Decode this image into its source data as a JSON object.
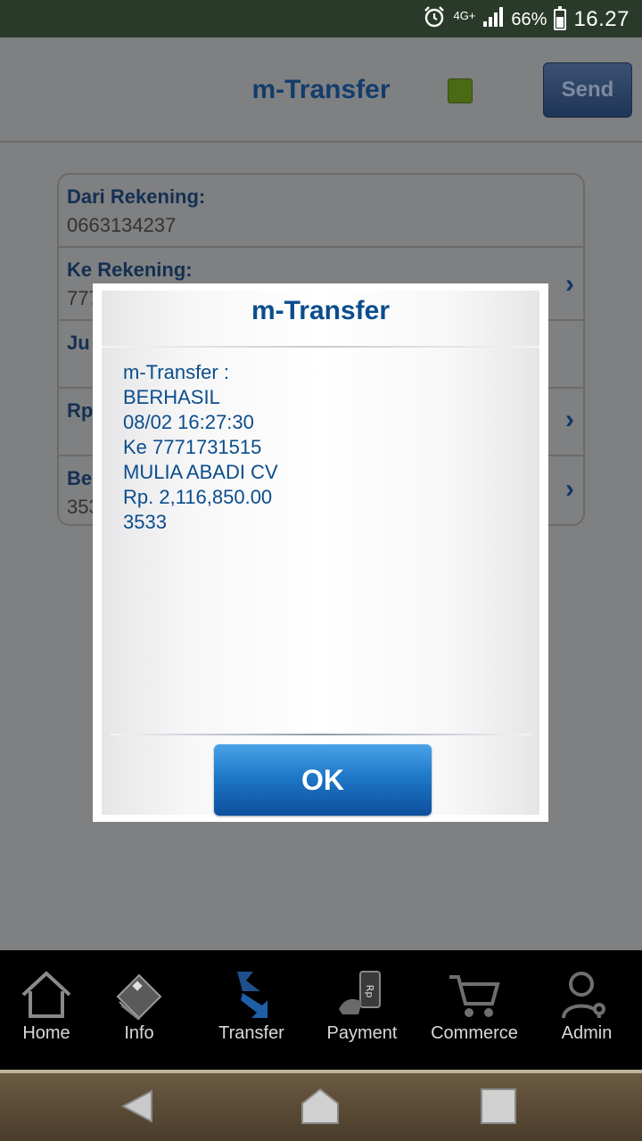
{
  "status_bar": {
    "alarm_icon": "alarm-clock-icon",
    "network": "4G+",
    "signal_icon": "signal-bars-icon",
    "battery_percent": "66%",
    "battery_icon": "battery-icon",
    "time": "16.27"
  },
  "header": {
    "title": "m-Transfer",
    "indicator_color": "#4a6a14",
    "send_label": "Send"
  },
  "form": {
    "dari_label": "Dari Rekening:",
    "dari_value": "0663134237",
    "ke_label": "Ke Rekening:",
    "ke_value_partial": "777",
    "jumlah_label_partial": "Ju",
    "rp_label_partial": "Rp",
    "berita_label_partial": "Be",
    "berita_value_partial": "353"
  },
  "dialog": {
    "title": "m-Transfer",
    "lines": [
      "m-Transfer :",
      "BERHASIL",
      "08/02 16:27:30",
      "Ke 7771731515",
      "MULIA ABADI CV",
      "Rp. 2,116,850.00",
      "3533"
    ],
    "ok_label": "OK"
  },
  "bottom_nav": {
    "items": [
      {
        "label": "Home",
        "icon": "home-icon"
      },
      {
        "label": "Info",
        "icon": "info-icon"
      },
      {
        "label": "Transfer",
        "icon": "transfer-icon"
      },
      {
        "label": "Payment",
        "icon": "payment-icon"
      },
      {
        "label": "Commerce",
        "icon": "cart-icon"
      },
      {
        "label": "Admin",
        "icon": "admin-icon"
      }
    ]
  },
  "system_nav": {
    "back_icon": "back-icon",
    "home_icon": "system-home-icon",
    "recents_icon": "recents-icon"
  },
  "colors": {
    "title_blue": "#0b4d8c",
    "ok_button": "#1f78c8",
    "nav_background": "#000000"
  }
}
